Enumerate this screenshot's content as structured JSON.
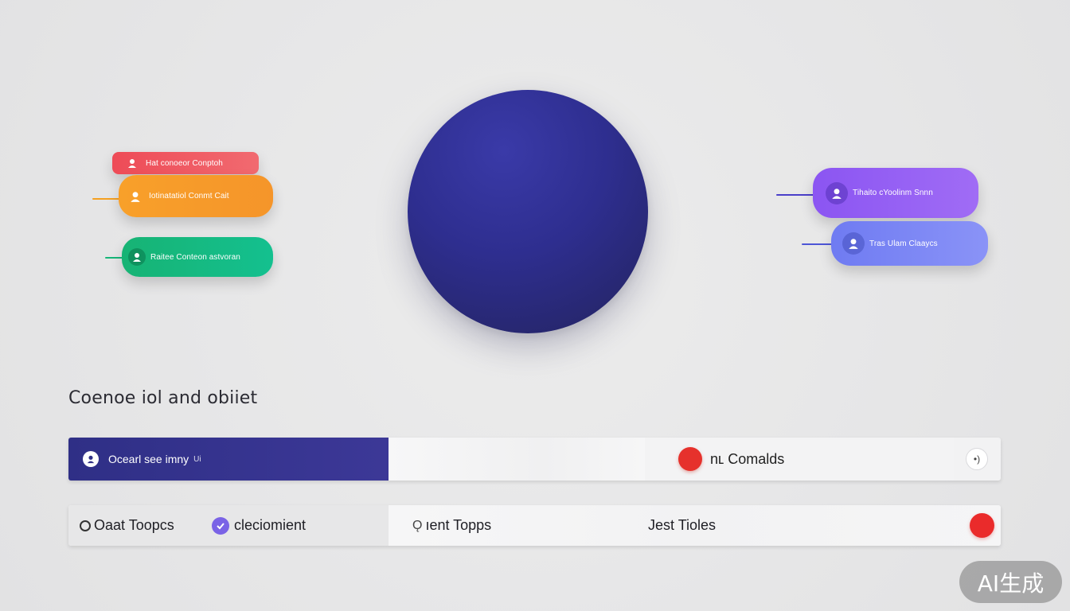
{
  "section_title": "Coenoe iol and obiiet",
  "left_pills": [
    {
      "label": "Hat conoeor Conptoh",
      "color": "#ee4b57"
    },
    {
      "label": "Iotinatatiol Conmt Cait",
      "color": "#f8a02a"
    },
    {
      "label": "Raitee Conteon astvoran",
      "color": "#17b374"
    }
  ],
  "right_pills": [
    {
      "label": "Tihaito cYoolinm Snnn",
      "color": "#8b55f2"
    },
    {
      "label": "Tras Ulam Claaycs",
      "color": "#6f7bf2"
    }
  ],
  "hero_circle_color": "#2e2e8f",
  "row1": {
    "dark_label": "Ocearl see imny",
    "dark_suffix": "Ui",
    "comm_label": "nʟ Comalds",
    "info_glyph": "•)"
  },
  "row2": {
    "item1": "Oaat Toopcs",
    "item2": "cleciomient",
    "item3": "ıent Topps",
    "item3_prefix": "Ǫ",
    "item4": "Jest Tioles"
  },
  "watermark": "AI生成",
  "colors": {
    "background": "#e7e7e8",
    "primary_dark": "#2f2f86",
    "accent_red": "#e6312c"
  }
}
